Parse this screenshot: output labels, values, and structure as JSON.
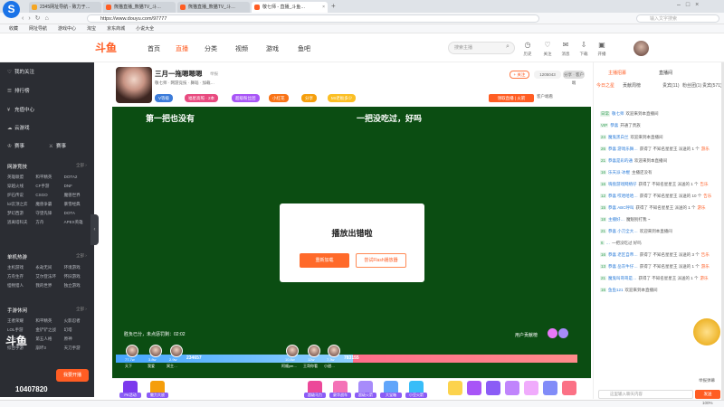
{
  "browser": {
    "tabs": [
      {
        "label": "2345网址导航 - 致力于…"
      },
      {
        "label": "熊猫直播_熊猫TV_斗…"
      },
      {
        "label": "熊猫直播_熊猫TV_斗…"
      },
      {
        "label": "敬七师 - 直播_斗鱼…"
      }
    ],
    "url": "https://www.douyu.com/97777",
    "search_placeholder": "输入文字搜索",
    "bookmarks": [
      "收藏",
      "网址导航",
      "游戏中心",
      "淘宝",
      "京东商城",
      "小说大全"
    ]
  },
  "site": {
    "logo_text": "斗鱼",
    "nav": [
      "首页",
      "直播",
      "分类",
      "视频",
      "游戏",
      "鱼吧"
    ],
    "search_placeholder": "搜索主播",
    "header_icons": [
      {
        "icon": "history-icon",
        "label": "历史"
      },
      {
        "icon": "follow-icon",
        "label": "关注"
      },
      {
        "icon": "message-icon",
        "label": "消息"
      },
      {
        "icon": "download-icon",
        "label": "下载"
      },
      {
        "icon": "mail-icon",
        "label": "开播"
      }
    ]
  },
  "sidebar": {
    "items": [
      {
        "icon": "heart-icon",
        "label": "我的关注"
      },
      {
        "icon": "rank-icon",
        "label": "排行榜"
      },
      {
        "icon": "charge-icon",
        "label": "充值中心"
      },
      {
        "icon": "cloud-icon",
        "label": "云游戏"
      }
    ],
    "events": [
      "赛事",
      "赛事"
    ],
    "sections": [
      {
        "title": "网游竞技",
        "more": "全部 ›",
        "games": [
          "英雄联盟",
          "和平精英",
          "DOTA2",
          "穿越火线",
          "CF手游",
          "DNF",
          "炉石传说",
          "CSGO",
          "魔兽世界",
          "lol云顶之弈",
          "魔兽争霸",
          "暴雪经典",
          "梦幻西游",
          "守望先锋",
          "DOTA",
          "逃离塔科夫",
          "方舟",
          "APEX英雄"
        ]
      },
      {
        "title": "单机热游",
        "more": "全部 ›",
        "games": [
          "主机游戏",
          "永劫无间",
          "环境游戏",
          "方舟生存",
          "艾尔登法环",
          "怀旧游戏",
          "怪物猎人",
          "我的世界",
          "独立游戏"
        ]
      },
      {
        "title": "手游休闲",
        "more": "全部 ›",
        "games": [
          "王者荣耀",
          "和平精英",
          "火影忍者",
          "LOL手游",
          "金铲铲之战",
          "幻塔",
          "COD手游",
          "第五人格",
          "原神",
          "综合手游",
          "崩坏3",
          "天刀手游"
        ]
      }
    ],
    "bottom_logo": "斗鱼",
    "bottom_count": "10407820",
    "bottom_promo": "我要开播"
  },
  "room": {
    "title": "三月一拖嗯嗯嗯",
    "title_suffix": "举报",
    "meta": "敬七师 · 网游竞技 · 舞蹈 · 加载…",
    "badges": [
      "V等级",
      "福星高照 · 2本",
      "超级粉丝团",
      "小红花",
      "分享",
      "Mr老板多少"
    ],
    "follow_label": "+ 关注",
    "fans_count": "1205043",
    "share_label": "分享 · 客户端",
    "report_label": "领取直播 | 火箭",
    "client_watch": "客户端看"
  },
  "player": {
    "overlay_text_left": "第一把也没有",
    "overlay_text_right": "一把没吃过，好吗",
    "error_title": "播放出错啦",
    "reload_label": "重新加载",
    "flash_label": "尝试Flash播放器",
    "score_text": "胜负已分，未点惩罚剩：02:02",
    "user_hot": "用户贡献榜",
    "pk_score_left": "234657",
    "pk_score_right": "783155",
    "pk_tags": [
      "天下",
      "我爱",
      "冥主…",
      "阿顺ym…",
      "王哥你看",
      "小甜…"
    ],
    "pk_values": [
      "77.7w",
      "3.8w",
      "2.9w",
      "10.8w",
      "12w",
      "7.3w"
    ]
  },
  "gift_bar": {
    "items": [
      "PK活动",
      "魅力大放",
      "…",
      "超级马力",
      "豪华战车",
      "超级火箭",
      "大宝箱",
      "小豆火箭"
    ]
  },
  "chat": {
    "tabs": [
      "主播招募",
      "直播间"
    ],
    "subtabs": [
      "今日之星",
      "贡献周榜",
      "贵宾(11)",
      "粉丝团(1)",
      "贵宾(571)"
    ],
    "lines": [
      {
        "lv": "日常",
        "name": "敬七师",
        "text": "欢迎来到本直播间"
      },
      {
        "lv": "VIP",
        "name": "恭喜",
        "text": "开通了贵族"
      },
      {
        "lv": "24",
        "name": "魔鬼黑白兰",
        "text": "欢迎来到本直播间"
      },
      {
        "lv": "26",
        "name": "恭喜 游戏乐舞…",
        "text": "获得了 不知名星星王 派送的 1 个",
        "hl": "游乐"
      },
      {
        "lv": "21",
        "name": "恭喜是彩的通",
        "text": "欢迎来到本直播间"
      },
      {
        "lv": "16",
        "name": "乐天派·冰棍",
        "text": "主播还没有"
      },
      {
        "lv": "16",
        "name": "嗨盘游戏网络仔",
        "text": "获得了 不知名星星王 派送的 1 个",
        "hl": "告乐"
      },
      {
        "lv": "12",
        "name": "恭喜 哎哈哈哈…",
        "text": "获得了 不知名星星王 派送的 10 个",
        "hl": "告乐"
      },
      {
        "lv": "15",
        "name": "恭喜 ABC呼叫",
        "text": "获得了 不知名星星王 派送的 1 个",
        "hl": "游乐"
      },
      {
        "lv": "18",
        "name": "主播好…",
        "text": "魔魁别打我 ~"
      },
      {
        "lv": "21",
        "name": "恭喜 小刀全大…",
        "text": "欢迎来到本直播间"
      },
      {
        "lv": "6",
        "name": "…",
        "text": "一把没吃过 好吗"
      },
      {
        "lv": "16",
        "name": "恭喜 老区自帝…",
        "text": "获得了 不知名星星王 派送的 3 个",
        "hl": "告乐"
      },
      {
        "lv": "13",
        "name": "恭喜 岳灰牛仔…",
        "text": "获得了 不知名星星王 派送的 1 个",
        "hl": "游乐"
      },
      {
        "lv": "21",
        "name": "魔鬼叫哥哥是…",
        "text": "获得了 不知名星星王 派送的 1 个",
        "hl": "游乐"
      },
      {
        "lv": "16",
        "name": "鱼鱼121",
        "text": "欢迎来到本直播间"
      }
    ],
    "input_placeholder": "这里输入聊天内容",
    "send_label": "发送",
    "footer_label": "举报弹幕"
  },
  "statusbar": {
    "left": "",
    "right": "100%"
  },
  "colors": {
    "accent": "#ff5d23",
    "sidebar_bg": "#2b2d33",
    "player_bg": "#0b4d12"
  }
}
